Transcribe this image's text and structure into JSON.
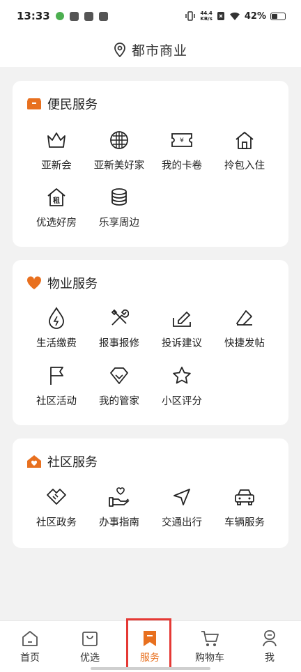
{
  "status_bar": {
    "time": "13:33",
    "net_speed": "44.4",
    "net_unit": "KB/s",
    "battery": "42%"
  },
  "header": {
    "title": "都市商业"
  },
  "sections": [
    {
      "title": "便民服务",
      "items": [
        "亚新会",
        "亚新美好家",
        "我的卡卷",
        "拎包入住",
        "优选好房",
        "乐享周边"
      ]
    },
    {
      "title": "物业服务",
      "items": [
        "生活缴费",
        "报事报修",
        "投诉建议",
        "快捷发帖",
        "社区活动",
        "我的管家",
        "小区评分"
      ]
    },
    {
      "title": "社区服务",
      "items": [
        "社区政务",
        "办事指南",
        "交通出行",
        "车辆服务"
      ]
    }
  ],
  "rent_glyph": "租",
  "coupon_glyph": "¥",
  "bottom_nav": [
    "首页",
    "优选",
    "服务",
    "购物车",
    "我"
  ],
  "colors": {
    "accent": "#e8701f",
    "highlight_box": "#e53935"
  }
}
